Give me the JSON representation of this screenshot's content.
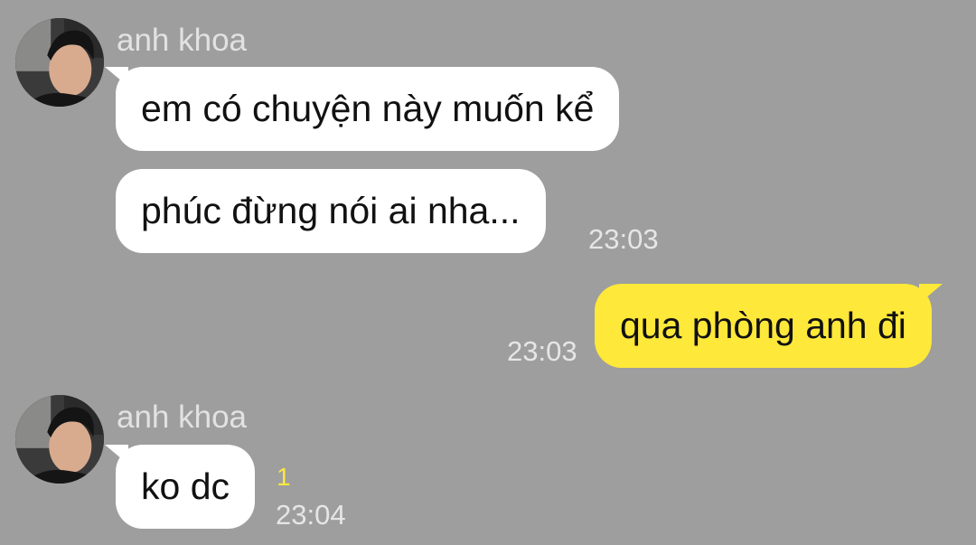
{
  "messages": [
    {
      "sender": "anh khoa",
      "avatar": "profile-photo",
      "bubbles": [
        "em có chuyện này muốn kể",
        "phúc đừng nói ai nha..."
      ],
      "time": "23:03"
    },
    {
      "from_me": true,
      "text": "qua phòng anh đi",
      "time": "23:03"
    },
    {
      "sender": "anh khoa",
      "avatar": "profile-photo",
      "text": "ko dc",
      "unread_count": "1",
      "time": "23:04"
    }
  ],
  "colors": {
    "background": "#9e9e9e",
    "incoming_bubble": "#ffffff",
    "outgoing_bubble": "#fee83a",
    "unread": "#fee83a"
  }
}
